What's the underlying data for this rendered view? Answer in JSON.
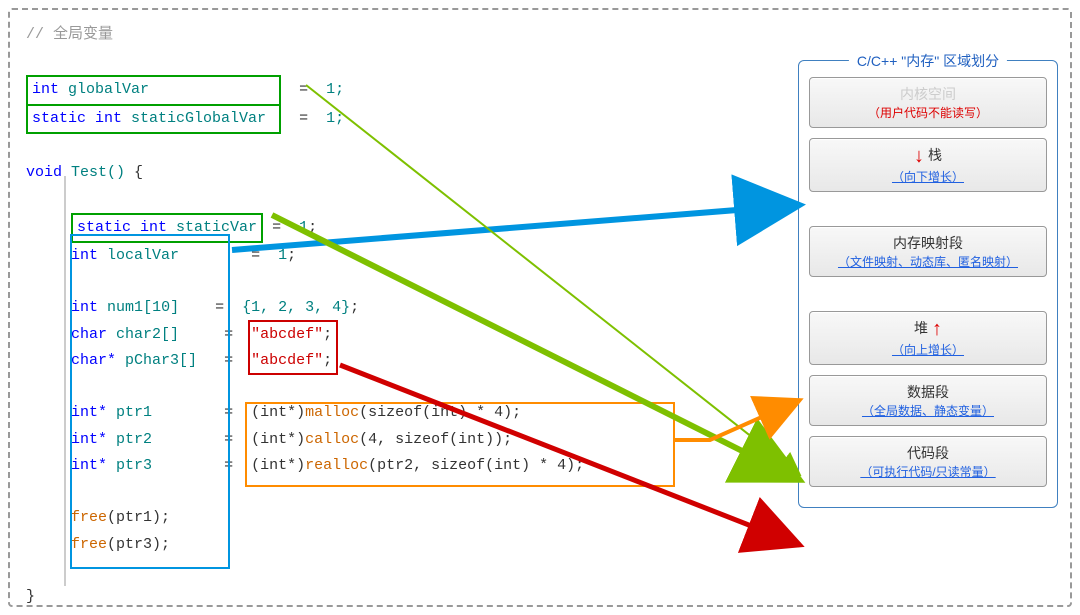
{
  "comment": "// 全局变量",
  "code": {
    "globalVar": {
      "type": "int",
      "name": "globalVar",
      "eq": "=",
      "val": "1;"
    },
    "staticGlobalVar": {
      "type": "static int",
      "name": "staticGlobalVar",
      "eq": "=",
      "val": "1;"
    },
    "funcDecl": {
      "type": "void",
      "name": "Test()",
      "brace": " {"
    },
    "staticVar": {
      "type": "static int",
      "name": "staticVar",
      "eq": "= ",
      "val": "1",
      "semi": ";"
    },
    "localVar": {
      "type": "int",
      "name": "localVar",
      "eq": "= ",
      "val": "1",
      "semi": ";"
    },
    "num1": {
      "type": "int",
      "name": "num1",
      "arr": "[10]",
      "eq": "= ",
      "vals": "{1, 2, 3, 4}",
      "semi": ";"
    },
    "char2": {
      "type": "char",
      "name": "char2[]",
      "eq": "= ",
      "val": "\"abcdef\"",
      "semi": ";"
    },
    "pChar3": {
      "type": "char*",
      "name": "pChar3[]",
      "eq": "= ",
      "val": "\"abcdef\"",
      "semi": ";"
    },
    "ptr1": {
      "type": "int*",
      "name": "ptr1",
      "eq": "= ",
      "cast": "(int*)",
      "fn": "malloc",
      "args": "(sizeof(int) * 4);"
    },
    "ptr2": {
      "type": "int*",
      "name": "ptr2",
      "eq": "= ",
      "cast": "(int*)",
      "fn": "calloc",
      "args": "(4, sizeof(int));"
    },
    "ptr3": {
      "type": "int*",
      "name": "ptr3",
      "eq": "= ",
      "cast": "(int*)",
      "fn": "realloc",
      "args": "(ptr2, sizeof(int) * 4);"
    },
    "free1": {
      "fn": "free",
      "args": "(ptr1);"
    },
    "free3": {
      "fn": "free",
      "args": "(ptr3);"
    },
    "closeBrace": "}"
  },
  "memoryPanel": {
    "title": "C/C++ \"内存\" 区域划分",
    "regions": [
      {
        "title": "内核空间",
        "sub": "（用户代码不能读写）",
        "disabled": true,
        "subRed": true
      },
      {
        "title": "栈",
        "sub": "（向下增长）",
        "arrow": "down"
      },
      {
        "title": "内存映射段",
        "sub": "（文件映射、动态库、匿名映射）"
      },
      {
        "title": "堆",
        "sub": "（向上增长）",
        "arrow": "up"
      },
      {
        "title": "数据段",
        "sub": "（全局数据、静态变量）"
      },
      {
        "title": "代码段",
        "sub": "（可执行代码/只读常量）"
      }
    ]
  }
}
